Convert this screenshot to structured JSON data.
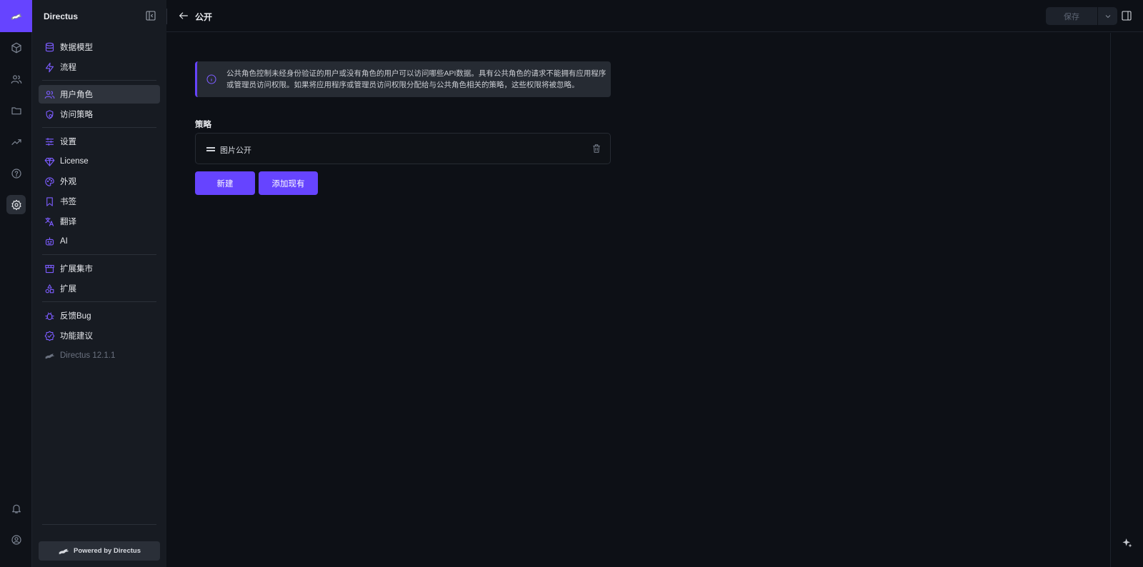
{
  "app": {
    "name": "Directus"
  },
  "header": {
    "title": "公开",
    "save_label": "保存"
  },
  "nav": {
    "items": [
      {
        "label": "数据模型",
        "icon": "database-icon"
      },
      {
        "label": "流程",
        "icon": "bolt-icon"
      },
      {
        "label": "用户角色",
        "icon": "users-icon",
        "active": true
      },
      {
        "label": "访问策略",
        "icon": "policy-icon"
      },
      {
        "label": "设置",
        "icon": "sliders-icon"
      },
      {
        "label": "License",
        "icon": "diamond-icon"
      },
      {
        "label": "外观",
        "icon": "palette-icon"
      },
      {
        "label": "书签",
        "icon": "bookmark-icon"
      },
      {
        "label": "翻译",
        "icon": "translate-icon"
      },
      {
        "label": "AI",
        "icon": "robot-icon"
      },
      {
        "label": "扩展集市",
        "icon": "store-icon"
      },
      {
        "label": "扩展",
        "icon": "shapes-icon"
      },
      {
        "label": "反馈Bug",
        "icon": "bug-icon"
      },
      {
        "label": "功能建议",
        "icon": "verified-icon"
      },
      {
        "label": "Directus 12.1.1",
        "icon": "directus-logo-icon"
      }
    ],
    "powered": "Powered by Directus"
  },
  "main": {
    "notice": "公共角色控制未经身份验证的用户或没有角色的用户可以访问哪些API数据。具有公共角色的请求不能拥有应用程序或管理员访问权限。如果将应用程序或管理员访问权限分配给与公共角色相关的策略，这些权限将被忽略。",
    "policies_label": "策略",
    "policies": [
      {
        "name": "图片公开"
      }
    ],
    "new_button": "新建",
    "add_existing_button": "添加现有"
  },
  "colors": {
    "accent": "#6644ff",
    "background": "#0d1016",
    "sidebar": "#171b22"
  }
}
